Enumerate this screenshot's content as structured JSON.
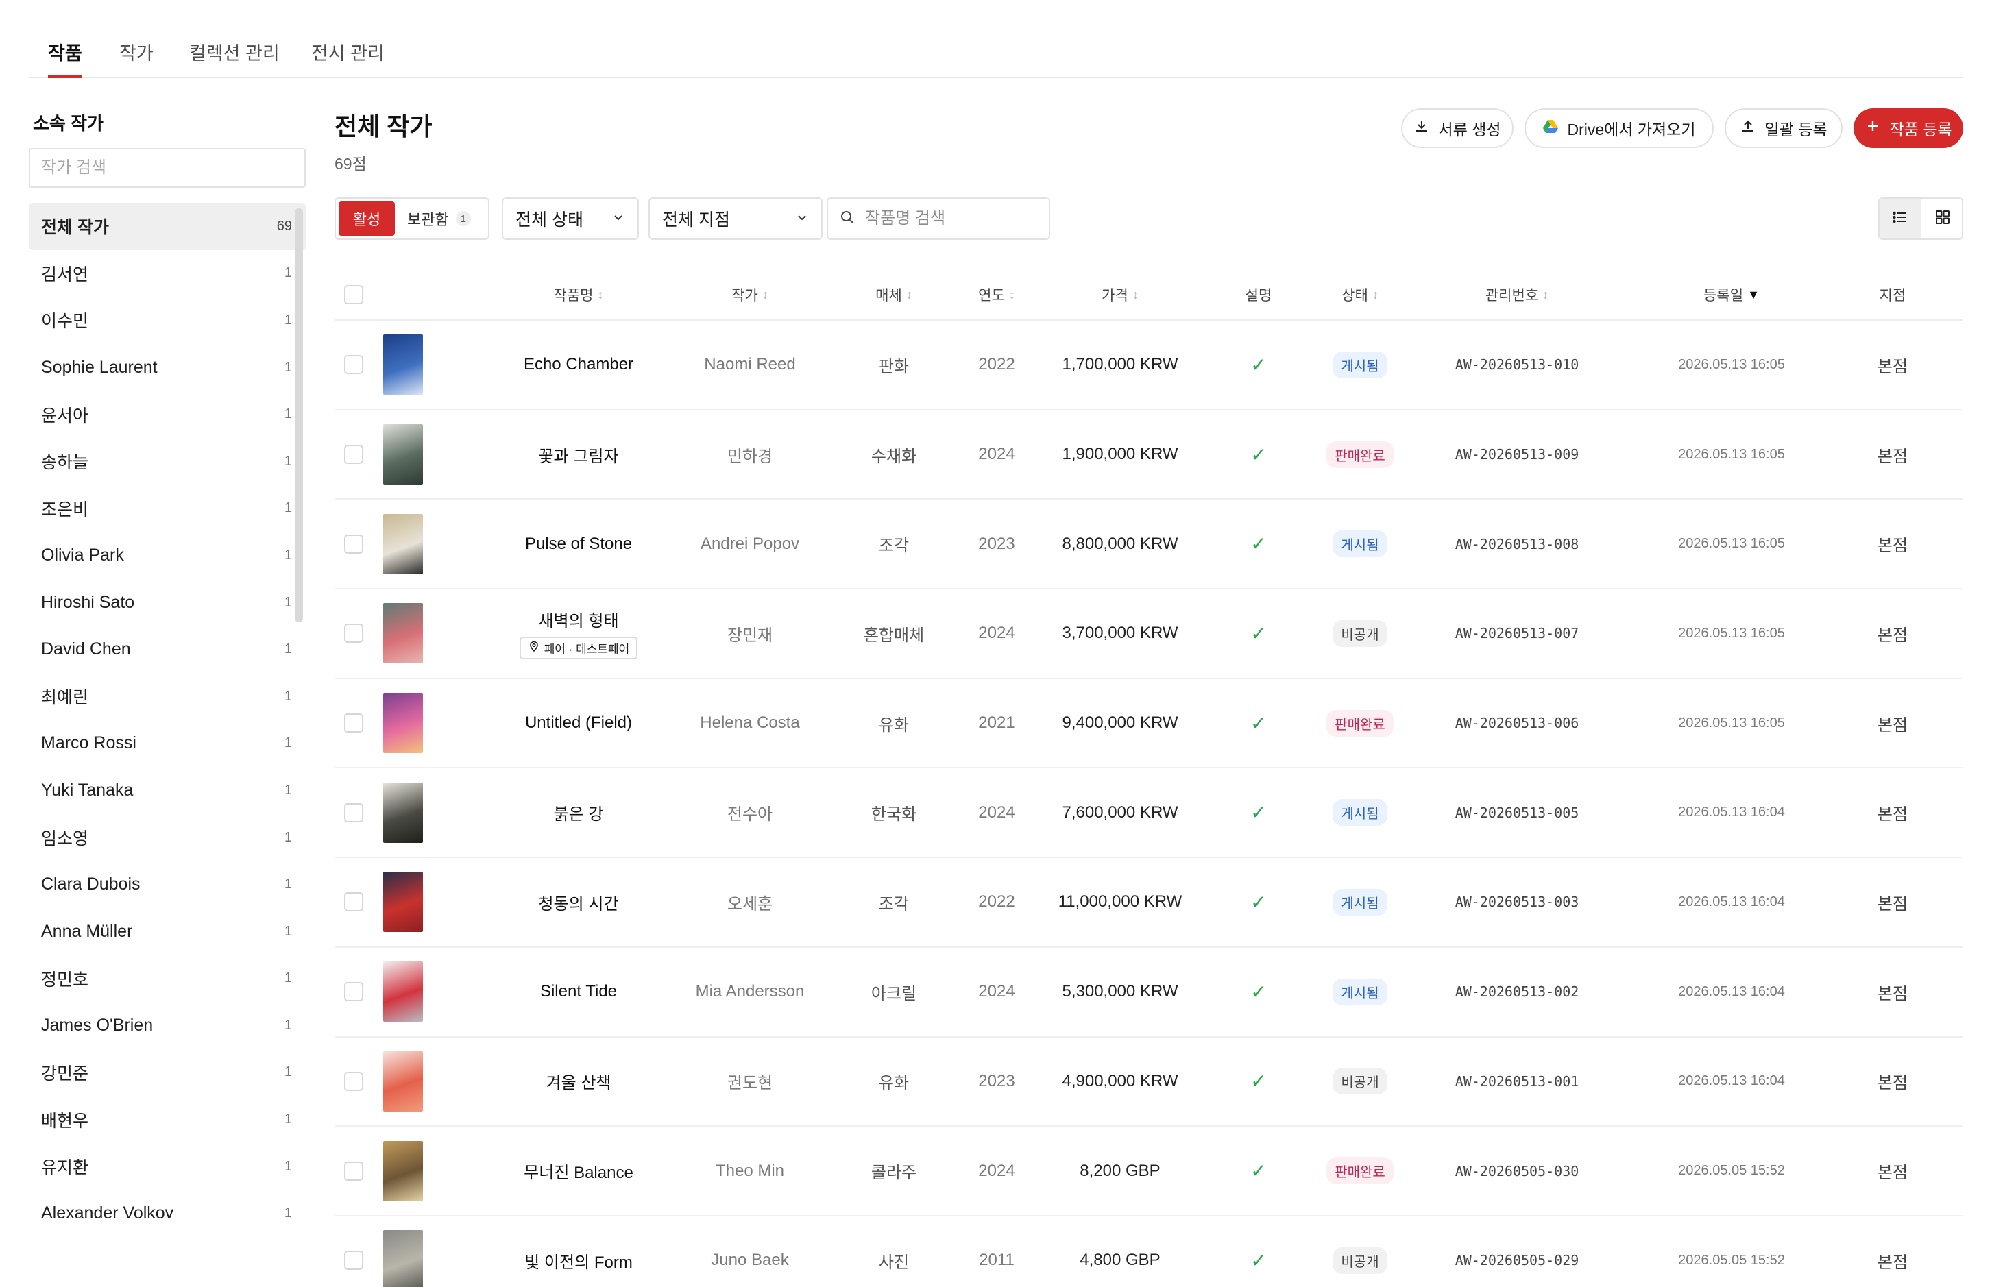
{
  "top_tabs": [
    "작품",
    "작가",
    "컬렉션 관리",
    "전시 관리"
  ],
  "sidebar": {
    "title": "소속 작가",
    "search_placeholder": "작가 검색",
    "items": [
      {
        "name": "전체 작가",
        "count": "69"
      },
      {
        "name": "김서연",
        "count": "1"
      },
      {
        "name": "이수민",
        "count": "1"
      },
      {
        "name": "Sophie Laurent",
        "count": "1"
      },
      {
        "name": "윤서아",
        "count": "1"
      },
      {
        "name": "송하늘",
        "count": "1"
      },
      {
        "name": "조은비",
        "count": "1"
      },
      {
        "name": "Olivia Park",
        "count": "1"
      },
      {
        "name": "Hiroshi Sato",
        "count": "1"
      },
      {
        "name": "David Chen",
        "count": "1"
      },
      {
        "name": "최예린",
        "count": "1"
      },
      {
        "name": "Marco Rossi",
        "count": "1"
      },
      {
        "name": "Yuki Tanaka",
        "count": "1"
      },
      {
        "name": "임소영",
        "count": "1"
      },
      {
        "name": "Clara Dubois",
        "count": "1"
      },
      {
        "name": "Anna Müller",
        "count": "1"
      },
      {
        "name": "정민호",
        "count": "1"
      },
      {
        "name": "James O'Brien",
        "count": "1"
      },
      {
        "name": "강민준",
        "count": "1"
      },
      {
        "name": "배현우",
        "count": "1"
      },
      {
        "name": "유지환",
        "count": "1"
      },
      {
        "name": "Alexander Volkov",
        "count": "1"
      }
    ]
  },
  "header": {
    "title": "전체 작가",
    "count": "69점",
    "buttons": {
      "docs": "서류 생성",
      "drive": "Drive에서 가져오기",
      "bulk": "일괄 등록",
      "add": "작품 등록"
    }
  },
  "filters": {
    "active": "활성",
    "archived": "보관함",
    "archived_count": "1",
    "status": "전체 상태",
    "branch": "전체 지점",
    "search_placeholder": "작품명 검색"
  },
  "table": {
    "headers": {
      "title": "작품명",
      "artist": "작가",
      "medium": "매체",
      "year": "연도",
      "price": "가격",
      "desc": "설명",
      "status": "상태",
      "code": "관리번호",
      "date": "등록일",
      "branch": "지점"
    },
    "sort_icon": "↕",
    "sort_active_icon": "▼",
    "check_glyph": "✓",
    "rows": [
      {
        "title": "Echo Chamber",
        "artist": "Naomi Reed",
        "medium": "판화",
        "year": "2022",
        "price": "1,700,000 KRW",
        "status": "게시됨",
        "status_kind": "pub",
        "code": "AW-20260513-010",
        "date": "2026.05.13 16:05",
        "branch": "본점",
        "thumb": [
          "#1d3f86",
          "#3f6fc0",
          "#dbe6f6"
        ]
      },
      {
        "title": "꽃과 그림자",
        "artist": "민하경",
        "medium": "수채화",
        "year": "2024",
        "price": "1,900,000 KRW",
        "status": "판매완료",
        "status_kind": "sold",
        "code": "AW-20260513-009",
        "date": "2026.05.13 16:05",
        "branch": "본점",
        "thumb": [
          "#dfe0da",
          "#5b6c60",
          "#2f3a35"
        ]
      },
      {
        "title": "Pulse of Stone",
        "artist": "Andrei Popov",
        "medium": "조각",
        "year": "2023",
        "price": "8,800,000 KRW",
        "status": "게시됨",
        "status_kind": "pub",
        "code": "AW-20260513-008",
        "date": "2026.05.13 16:05",
        "branch": "본점",
        "thumb": [
          "#c9b891",
          "#e7e2d6",
          "#2b2b2b"
        ]
      },
      {
        "title": "새벽의 형태",
        "artist": "장민재",
        "medium": "혼합매체",
        "year": "2024",
        "price": "3,700,000 KRW",
        "status": "비공개",
        "status_kind": "priv",
        "code": "AW-20260513-007",
        "date": "2026.05.13 16:05",
        "branch": "본점",
        "thumb": [
          "#5f7c78",
          "#d76f74",
          "#e9b6b2"
        ],
        "location": "페어 · 테스트페어"
      },
      {
        "title": "Untitled (Field)",
        "artist": "Helena Costa",
        "medium": "유화",
        "year": "2021",
        "price": "9,400,000 KRW",
        "status": "판매완료",
        "status_kind": "sold",
        "code": "AW-20260513-006",
        "date": "2026.05.13 16:05",
        "branch": "본점",
        "thumb": [
          "#7a3f8f",
          "#e46aa0",
          "#f4c27a"
        ]
      },
      {
        "title": "붉은 강",
        "artist": "전수아",
        "medium": "한국화",
        "year": "2024",
        "price": "7,600,000 KRW",
        "status": "게시됨",
        "status_kind": "pub",
        "code": "AW-20260513-005",
        "date": "2026.05.13 16:04",
        "branch": "본점",
        "thumb": [
          "#e7e4da",
          "#4b4b44",
          "#1f1f1c"
        ]
      },
      {
        "title": "청동의 시간",
        "artist": "오세훈",
        "medium": "조각",
        "year": "2022",
        "price": "11,000,000 KRW",
        "status": "게시됨",
        "status_kind": "pub",
        "code": "AW-20260513-003",
        "date": "2026.05.13 16:04",
        "branch": "본점",
        "thumb": [
          "#2a2f4a",
          "#c8322e",
          "#8e2024"
        ]
      },
      {
        "title": "Silent Tide",
        "artist": "Mia Andersson",
        "medium": "아크릴",
        "year": "2024",
        "price": "5,300,000 KRW",
        "status": "게시됨",
        "status_kind": "pub",
        "code": "AW-20260513-002",
        "date": "2026.05.13 16:04",
        "branch": "본점",
        "thumb": [
          "#f2eeee",
          "#d2343f",
          "#b9bcc3"
        ]
      },
      {
        "title": "겨울 산책",
        "artist": "권도현",
        "medium": "유화",
        "year": "2023",
        "price": "4,900,000 KRW",
        "status": "비공개",
        "status_kind": "priv",
        "code": "AW-20260513-001",
        "date": "2026.05.13 16:04",
        "branch": "본점",
        "thumb": [
          "#f6e4dc",
          "#e4604a",
          "#f39b7d"
        ]
      },
      {
        "title": "무너진 Balance",
        "artist": "Theo Min",
        "medium": "콜라주",
        "year": "2024",
        "price": "8,200 GBP",
        "status": "판매완료",
        "status_kind": "sold",
        "code": "AW-20260505-030",
        "date": "2026.05.05 15:52",
        "branch": "본점",
        "thumb": [
          "#c29a5a",
          "#6d5535",
          "#e5d3a6"
        ]
      },
      {
        "title": "빛 이전의 Form",
        "artist": "Juno Baek",
        "medium": "사진",
        "year": "2011",
        "price": "4,800 GBP",
        "status": "비공개",
        "status_kind": "priv",
        "code": "AW-20260505-029",
        "date": "2026.05.05 15:52",
        "branch": "본점",
        "thumb": [
          "#8a8a86",
          "#b9b5aa",
          "#555550"
        ]
      }
    ]
  },
  "colors": {
    "accent": "#d42a2a",
    "published": "#2a62c6",
    "sold": "#c32353",
    "check": "#27a74a"
  },
  "icons": {
    "docs": "download-icon",
    "drive": "google-drive-icon",
    "bulk": "upload-icon",
    "add": "plus-icon",
    "search": "search-icon",
    "dropdown": "chevron-down-icon",
    "list": "list-view-icon",
    "grid": "grid-view-icon",
    "location": "location-pin-icon"
  }
}
